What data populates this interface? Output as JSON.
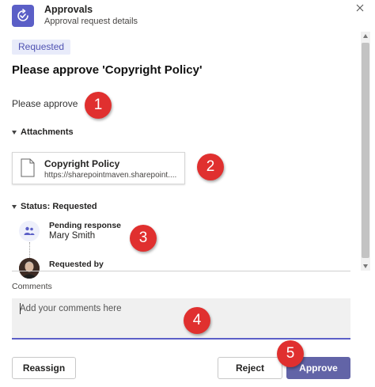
{
  "header": {
    "title": "Approvals",
    "subtitle": "Approval request details",
    "app_icon": "approvals-icon",
    "close_icon": "close-icon"
  },
  "status_badge": "Requested",
  "request_title": "Please approve 'Copyright Policy'",
  "message": "Please approve",
  "attachments": {
    "label": "Attachments",
    "items": [
      {
        "title": "Copyright Policy",
        "url": "https://sharepointmaven.sharepoint...."
      }
    ]
  },
  "status": {
    "label": "Status: Requested",
    "entries": [
      {
        "label": "Pending response",
        "name": "Mary Smith",
        "icon": "people-icon"
      },
      {
        "label": "Requested by",
        "icon": "avatar"
      }
    ]
  },
  "comments": {
    "label": "Comments",
    "placeholder": "Add your comments here"
  },
  "buttons": {
    "reassign": "Reassign",
    "reject": "Reject",
    "approve": "Approve"
  },
  "markers": [
    "1",
    "2",
    "3",
    "4",
    "5"
  ],
  "colors": {
    "accent": "#6264a7",
    "badge_bg": "#e8ebfa",
    "marker": "#e0302f"
  }
}
